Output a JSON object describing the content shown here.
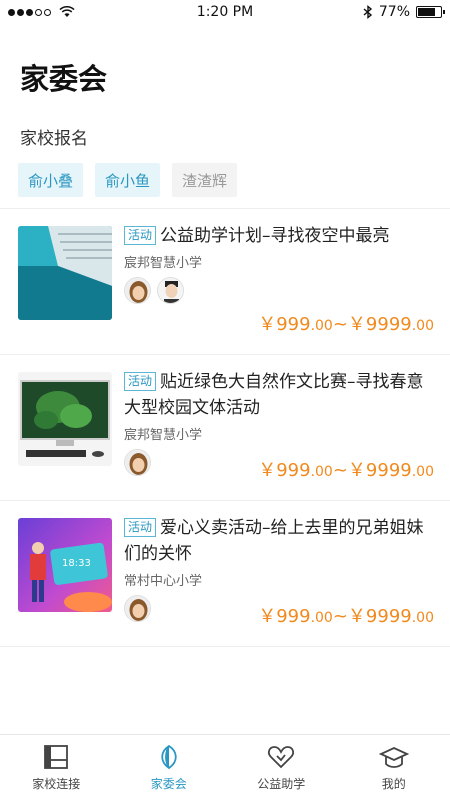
{
  "status_bar": {
    "time": "1:20 PM",
    "battery": "77%",
    "battery_level": 0.77
  },
  "page_title": "家委会",
  "section_title": "家校报名",
  "chips": [
    {
      "label": "俞小叠",
      "active": true
    },
    {
      "label": "俞小鱼",
      "active": true
    },
    {
      "label": "渣渣辉",
      "active": false
    }
  ],
  "activities": [
    {
      "tag": "活动",
      "title": "公益助学计划–寻找夜空中最亮",
      "school": "宸邦智慧小学",
      "price_min": "999",
      "price_min_dec": ".00",
      "price_sep": "~",
      "price_max": "9999",
      "price_max_dec": ".00",
      "currency": "￥"
    },
    {
      "tag": "活动",
      "title": "贴近绿色大自然作文比赛–寻找春意大型校园文体活动",
      "school": "宸邦智慧小学",
      "price_min": "999",
      "price_min_dec": ".00",
      "price_sep": "~",
      "price_max": "9999",
      "price_max_dec": ".00",
      "currency": "￥"
    },
    {
      "tag": "活动",
      "title": "爱心义卖活动–给上去里的兄弟姐妹们的关怀",
      "school": "常村中心小学",
      "price_min": "999",
      "price_min_dec": ".00",
      "price_sep": "~",
      "price_max": "9999",
      "price_max_dec": ".00",
      "currency": "￥"
    }
  ],
  "tabbar": [
    {
      "label": "家校连接",
      "icon": "home-connect-icon",
      "active": false
    },
    {
      "label": "家委会",
      "icon": "leaf-icon",
      "active": true
    },
    {
      "label": "公益助学",
      "icon": "heart-icon",
      "active": false
    },
    {
      "label": "我的",
      "icon": "graduation-cap-icon",
      "active": false
    }
  ],
  "colors": {
    "accent": "#2a97c2",
    "price": "#f18a1e"
  }
}
